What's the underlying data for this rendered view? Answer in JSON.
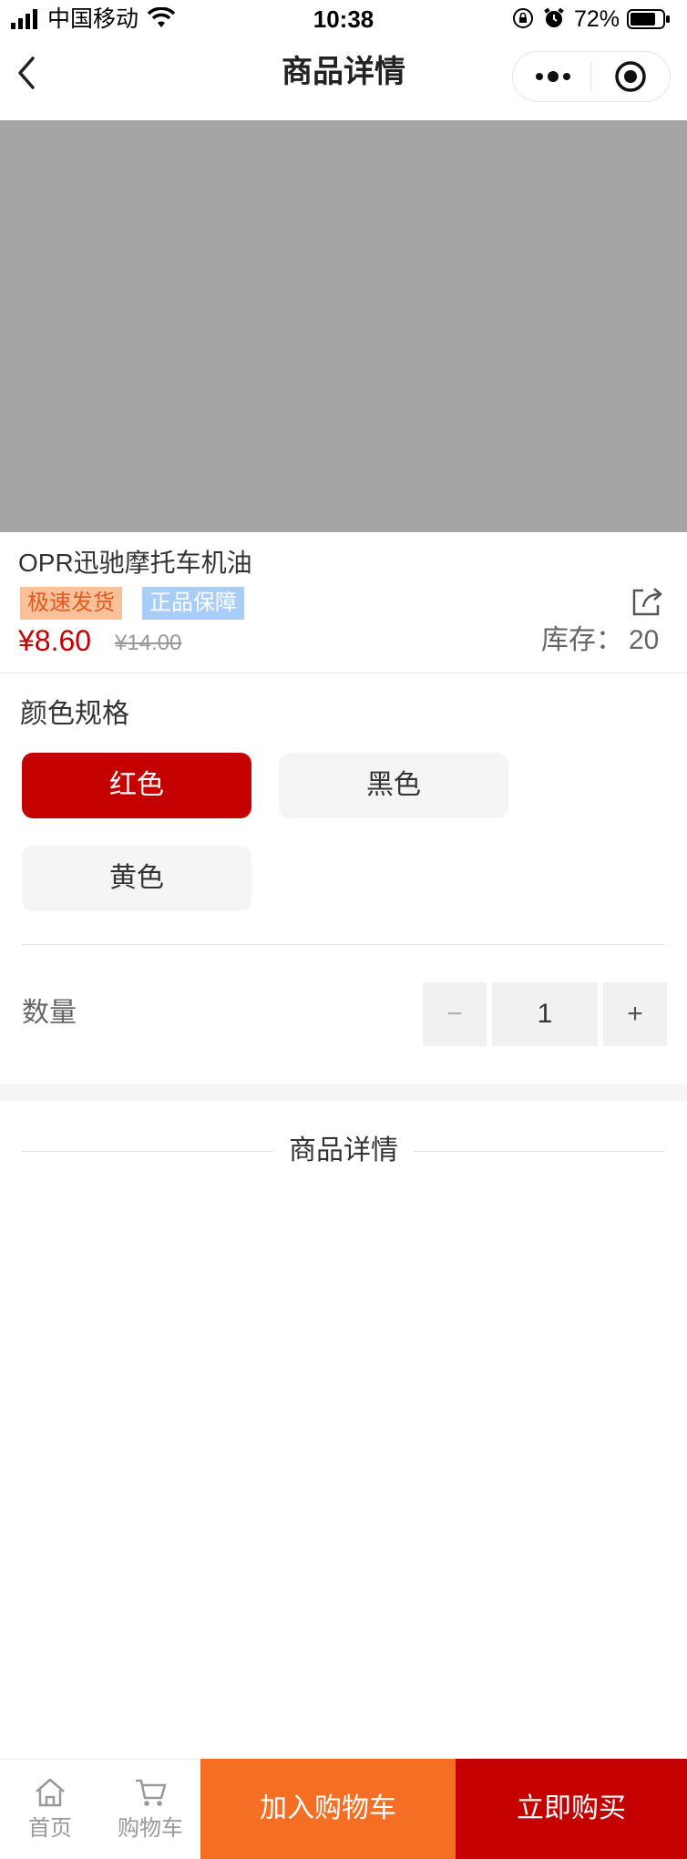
{
  "status_bar": {
    "carrier": "中国移动",
    "time": "10:38",
    "battery": "72%"
  },
  "nav": {
    "title": "商品详情"
  },
  "product": {
    "name": "OPR迅驰摩托车机油",
    "tags": [
      "极速发货",
      "正品保障"
    ],
    "price": "¥8.60",
    "original_price": "¥14.00",
    "stock_label": "库存：",
    "stock_value": "20"
  },
  "spec": {
    "title": "颜色规格",
    "options": [
      "红色",
      "黑色",
      "黄色"
    ],
    "selected": "红色"
  },
  "quantity": {
    "label": "数量",
    "minus": "−",
    "value": "1",
    "plus": "+"
  },
  "detail": {
    "title": "商品详情"
  },
  "bottom_bar": {
    "home_label": "首页",
    "cart_label": "购物车",
    "add_to_cart_label": "加入购物车",
    "buy_now_label": "立即购买"
  },
  "colors": {
    "primary_red": "#c40000",
    "orange": "#f46f24",
    "text_main": "#333333",
    "text_secondary": "#666666",
    "text_muted": "#999999"
  }
}
